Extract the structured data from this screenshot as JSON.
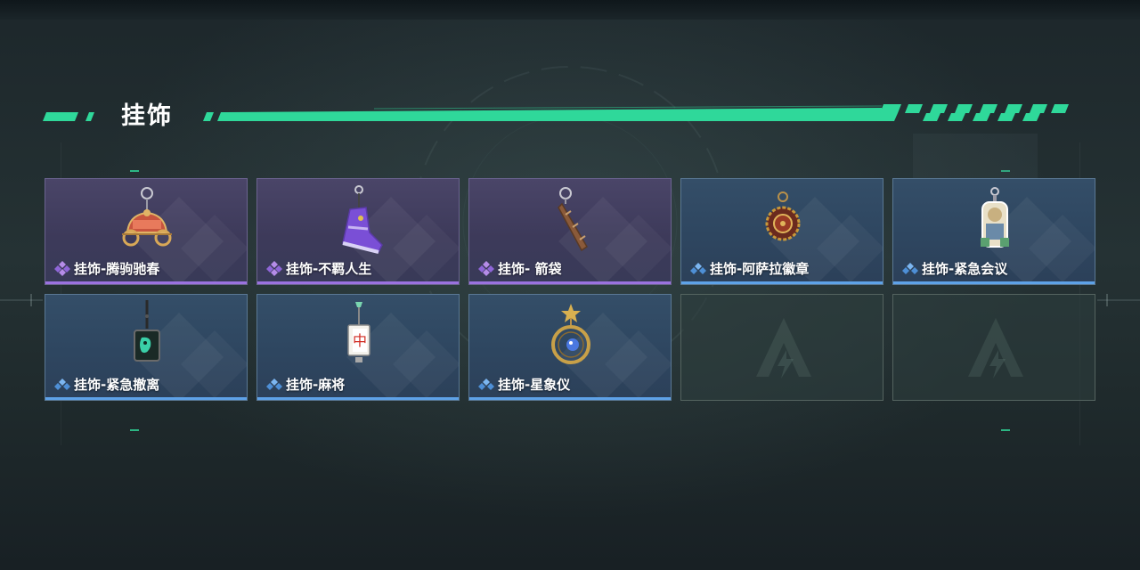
{
  "section": {
    "title": "挂饰"
  },
  "colors": {
    "accent": "#2fd89a",
    "purple_rarity": "#9b72e0",
    "blue_rarity": "#5ea2e8"
  },
  "items": [
    {
      "name": "挂饰-腾驹驰春",
      "rarity": "purple",
      "icon": "carriage-charm-icon"
    },
    {
      "name": "挂饰-不羁人生",
      "rarity": "purple",
      "icon": "sneaker-charm-icon"
    },
    {
      "name": "挂饰- 箭袋",
      "rarity": "purple",
      "icon": "quiver-charm-icon"
    },
    {
      "name": "挂饰-阿萨拉徽章",
      "rarity": "blue",
      "icon": "badge-charm-icon"
    },
    {
      "name": "挂饰-紧急会议",
      "rarity": "blue",
      "icon": "figure-charm-icon"
    },
    {
      "name": "挂饰-紧急撤离",
      "rarity": "blue",
      "icon": "green-tag-charm-icon"
    },
    {
      "name": "挂饰-麻将",
      "rarity": "blue",
      "icon": "mahjong-tile-charm-icon"
    },
    {
      "name": "挂饰-星象仪",
      "rarity": "blue",
      "icon": "astrolabe-charm-icon"
    },
    {
      "name": "",
      "rarity": "empty",
      "icon": "empty-slot-logo-icon"
    },
    {
      "name": "",
      "rarity": "empty",
      "icon": "empty-slot-logo-icon"
    }
  ]
}
